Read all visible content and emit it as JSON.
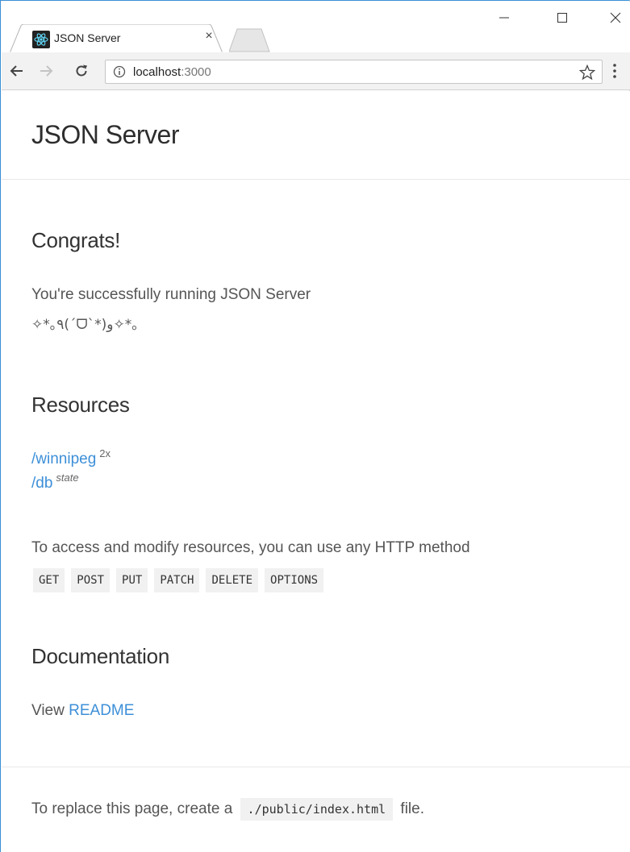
{
  "browser": {
    "tab_title": "JSON Server",
    "tab_close": "×",
    "url_host": "localhost",
    "url_port": ":3000"
  },
  "page": {
    "site_title": "JSON Server",
    "congrats": {
      "heading": "Congrats!",
      "message": "You're successfully running JSON Server",
      "kaomoji": "✧*｡٩(ˊᗜˋ*)و✧*｡"
    },
    "resources": {
      "heading": "Resources",
      "items": [
        {
          "path": "/winnipeg",
          "note": "2x"
        },
        {
          "path": "/db",
          "note": "state"
        }
      ],
      "access_text": "To access and modify resources, you can use any HTTP method",
      "methods": [
        "GET",
        "POST",
        "PUT",
        "PATCH",
        "DELETE",
        "OPTIONS"
      ]
    },
    "documentation": {
      "heading": "Documentation",
      "view_label": "View",
      "readme_link": "README"
    },
    "footer": {
      "prefix": "To replace this page, create a",
      "file": "./public/index.html",
      "suffix": "file."
    }
  },
  "colors": {
    "link": "#3d8fd8",
    "window_border": "#3c8fd6",
    "code_bg": "#f1f1f1"
  }
}
